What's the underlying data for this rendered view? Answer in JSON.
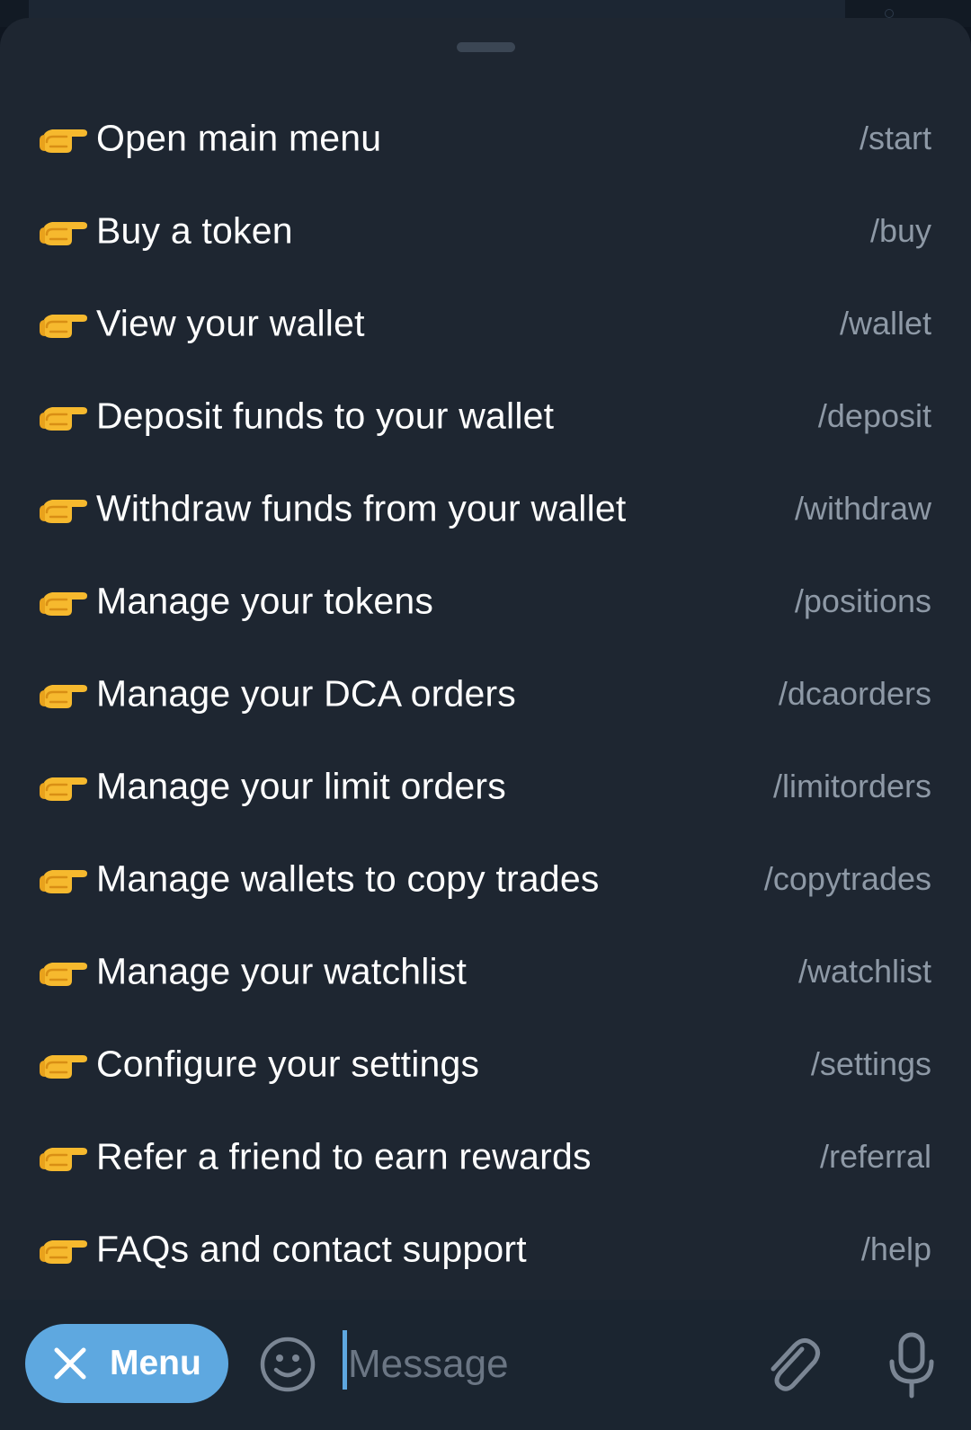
{
  "commands": [
    {
      "description": "Open main menu",
      "command": "/start"
    },
    {
      "description": "Buy a token",
      "command": "/buy"
    },
    {
      "description": "View your wallet",
      "command": "/wallet"
    },
    {
      "description": "Deposit funds to your wallet",
      "command": "/deposit"
    },
    {
      "description": "Withdraw funds from your wallet",
      "command": "/withdraw"
    },
    {
      "description": "Manage your tokens",
      "command": "/positions"
    },
    {
      "description": "Manage your DCA orders",
      "command": "/dcaorders"
    },
    {
      "description": "Manage your limit orders",
      "command": "/limitorders"
    },
    {
      "description": "Manage wallets to copy trades",
      "command": "/copytrades"
    },
    {
      "description": "Manage your watchlist",
      "command": "/watchlist"
    },
    {
      "description": "Configure your settings",
      "command": "/settings"
    },
    {
      "description": "Refer a friend to earn rewards",
      "command": "/referral"
    },
    {
      "description": "FAQs and contact support",
      "command": "/help"
    }
  ],
  "command_icon": "backhand-index-pointing-right-emoji",
  "bottom_bar": {
    "menu_button": {
      "label": "Menu",
      "icon": "close-icon"
    },
    "message_input": {
      "placeholder": "Message",
      "value": ""
    },
    "icons": [
      "emoji-icon",
      "attach-icon",
      "microphone-icon"
    ]
  },
  "colors": {
    "sheet_background": "#1e2631",
    "command_text": "#ffffff",
    "command_name": "#8e99a6",
    "menu_button": "#5ea8e0",
    "bottom_bar": "#1b2530"
  }
}
